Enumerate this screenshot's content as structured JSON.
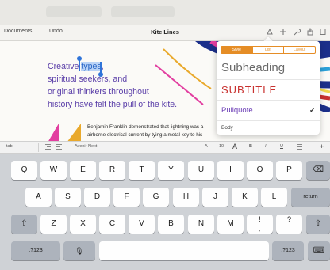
{
  "toolbar": {
    "documents_label": "Documents",
    "undo_label": "Undo",
    "title": "Kite Lines",
    "icons": [
      "paintbrush-icon",
      "plus-icon",
      "wrench-icon",
      "share-icon",
      "more-icon"
    ]
  },
  "document": {
    "hero_pre": "Creative ",
    "hero_selected": "types",
    "hero_post": ",",
    "hero_line2": "spiritual seekers, and",
    "hero_line3": "original thinkers throughout",
    "hero_line4": "history have felt the pull of the kite.",
    "para_line1": "Benjamin Franklin demonstrated that lightning was a",
    "para_line2": "airborne electrical current by tying a metal key to his",
    "accent_color": "#5a3ea8",
    "selection_color": "#b9d3f6"
  },
  "popover": {
    "tabs": [
      "Style",
      "List",
      "Layout"
    ],
    "active_tab": "Style",
    "styles": {
      "subheading": "Subheading",
      "subtitle": "SUBTITLE",
      "pullquote": "Pullquote",
      "body": "Body"
    },
    "selected_style": "Pullquote",
    "accent_color": "#e58d26"
  },
  "format_bar": {
    "tab_label": "tab",
    "font_name": "Avenir Next",
    "size_small": "A",
    "size_value": "10",
    "size_large": "A",
    "bold": "B",
    "italic": "I",
    "underline": "U"
  },
  "keyboard": {
    "row1": [
      "Q",
      "W",
      "E",
      "R",
      "T",
      "Y",
      "U",
      "I",
      "O",
      "P"
    ],
    "row2": [
      "A",
      "S",
      "D",
      "F",
      "G",
      "H",
      "J",
      "K",
      "L"
    ],
    "row3": [
      "Z",
      "X",
      "C",
      "V",
      "B",
      "N",
      "M",
      "!\n,",
      "?\n."
    ],
    "numbers_label": ".?123",
    "return_label": "return",
    "shift_glyph": "⇧",
    "delete_glyph": "⌫",
    "mic_glyph": "🎙",
    "hide_glyph": "⌨"
  }
}
